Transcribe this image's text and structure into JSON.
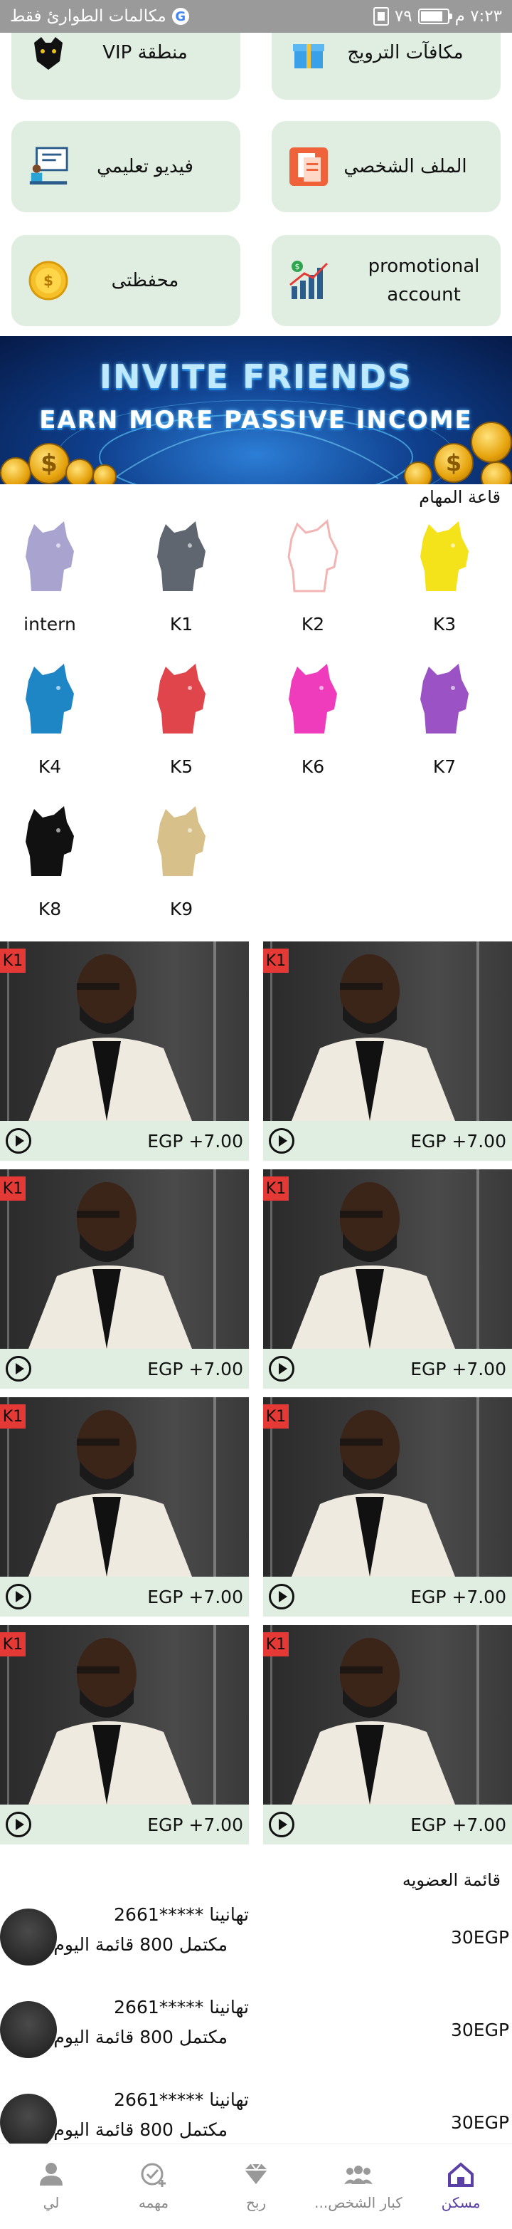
{
  "status_bar": {
    "time": "٧:٢٣ م",
    "battery_level": "٧٩",
    "notification": "مكالمات الطوارئ فقط"
  },
  "tiles": {
    "promo_rewards": "مكافآت الترويج",
    "vip_zone": "VIP منطقة",
    "profile": "الملف الشخصي",
    "tutorial_video": "فيديو تعليمي",
    "promotional_account": "promotional account",
    "wallet": "محفظتى"
  },
  "banner": {
    "line1": "INVITE FRIENDS",
    "line2": "EARN MORE PASSIVE INCOME"
  },
  "task_hall": {
    "title": "قاعة المهام",
    "levels": [
      {
        "label": "intern",
        "color": "#a9a3cf"
      },
      {
        "label": "K1",
        "color": "#5f6670"
      },
      {
        "label": "K2",
        "color": "#f3b4b4"
      },
      {
        "label": "K3",
        "color": "#f4e21a"
      },
      {
        "label": "K4",
        "color": "#1f86c6"
      },
      {
        "label": "K5",
        "color": "#e0454b"
      },
      {
        "label": "K6",
        "color": "#ee3cbc"
      },
      {
        "label": "K7",
        "color": "#9a52c4"
      },
      {
        "label": "K8",
        "color": "#111111"
      },
      {
        "label": "K9",
        "color": "#d8c08a"
      }
    ]
  },
  "videos": [
    {
      "badge": "K1",
      "reward": "EGP +7.00"
    },
    {
      "badge": "K1",
      "reward": "EGP +7.00"
    },
    {
      "badge": "K1",
      "reward": "EGP +7.00"
    },
    {
      "badge": "K1",
      "reward": "EGP +7.00"
    },
    {
      "badge": "K1",
      "reward": "EGP +7.00"
    },
    {
      "badge": "K1",
      "reward": "EGP +7.00"
    },
    {
      "badge": "K1",
      "reward": "EGP +7.00"
    },
    {
      "badge": "K1",
      "reward": "EGP +7.00"
    }
  ],
  "membership": {
    "title": "قائمة العضويه",
    "rows": [
      {
        "line1": "تهانينا *****2661",
        "line2": "مكتمل 800 قائمة اليوم",
        "amount": "30EGP"
      },
      {
        "line1": "تهانينا *****2661",
        "line2": "مكتمل 800 قائمة اليوم",
        "amount": "30EGP"
      },
      {
        "line1": "تهانينا *****2661",
        "line2": "مكتمل 800 قائمة اليوم",
        "amount": "30EGP"
      }
    ]
  },
  "bottom_nav": {
    "home": "مسكن",
    "team": "كبار الشخص...",
    "profit": "ربح",
    "tasks": "مهمه",
    "me": "لي",
    "active_color": "#5a3fa6"
  }
}
